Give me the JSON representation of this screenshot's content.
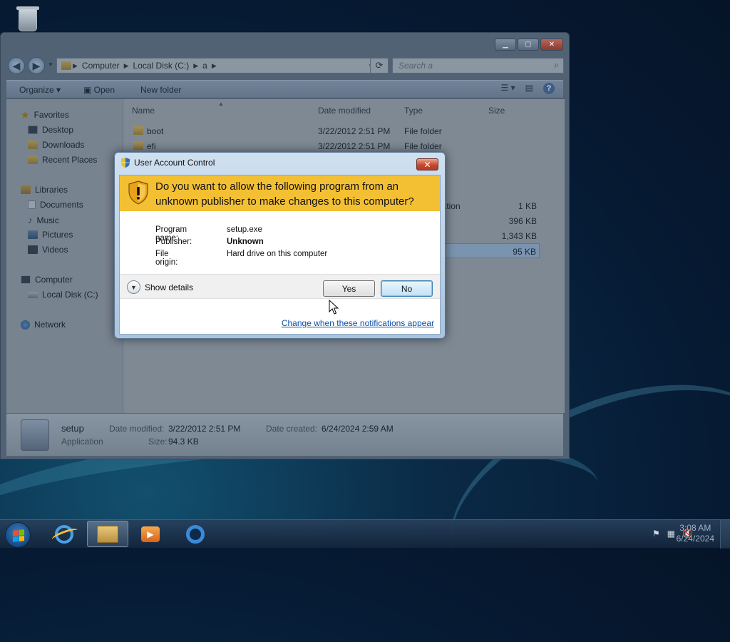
{
  "explorer": {
    "address": [
      "Computer",
      "Local Disk (C:)",
      "a"
    ],
    "search_placeholder": "Search a",
    "toolbar": {
      "organize": "Organize",
      "open": "Open",
      "new_folder": "New folder"
    },
    "nav": {
      "favorites": "Favorites",
      "desktop": "Desktop",
      "downloads": "Downloads",
      "recent": "Recent Places",
      "libraries": "Libraries",
      "documents": "Documents",
      "music": "Music",
      "pictures": "Pictures",
      "videos": "Videos",
      "computer": "Computer",
      "local_disk": "Local Disk (C:)",
      "network": "Network"
    },
    "columns": {
      "name": "Name",
      "date": "Date modified",
      "type": "Type",
      "size": "Size"
    },
    "files": [
      {
        "name": "boot",
        "date": "3/22/2012 2:51 PM",
        "type": "File folder",
        "size": ""
      },
      {
        "name": "efi",
        "date": "3/22/2012 2:51 PM",
        "type": "File folder",
        "size": ""
      },
      {
        "name": "",
        "date": "",
        "type": "nation",
        "size": "1 KB"
      },
      {
        "name": "",
        "date": "",
        "type": "",
        "size": "396 KB"
      },
      {
        "name": "",
        "date": "",
        "type": "",
        "size": "1,343 KB"
      },
      {
        "name": "",
        "date": "",
        "type": "",
        "size": "95 KB"
      }
    ],
    "details": {
      "name": "setup",
      "kind": "Application",
      "date_modified_label": "Date modified:",
      "date_modified": "3/22/2012 2:51 PM",
      "size_label": "Size:",
      "size": "94.3 KB",
      "date_created_label": "Date created:",
      "date_created": "6/24/2024 2:59 AM"
    }
  },
  "uac": {
    "title": "User Account Control",
    "question": "Do you want to allow the following program from an unknown publisher to make changes to this computer?",
    "program_label": "Program name:",
    "program": "setup.exe",
    "publisher_label": "Publisher:",
    "publisher": "Unknown",
    "origin_label": "File origin:",
    "origin": "Hard drive on this computer",
    "show_details": "Show details",
    "yes": "Yes",
    "no": "No",
    "link": "Change when these notifications appear",
    "close_glyph": "✕"
  },
  "taskbar": {
    "time": "3:08 AM",
    "date": "6/24/2024"
  },
  "colors": {
    "uac_banner": "#f3c034",
    "link": "#0b4fa8"
  }
}
